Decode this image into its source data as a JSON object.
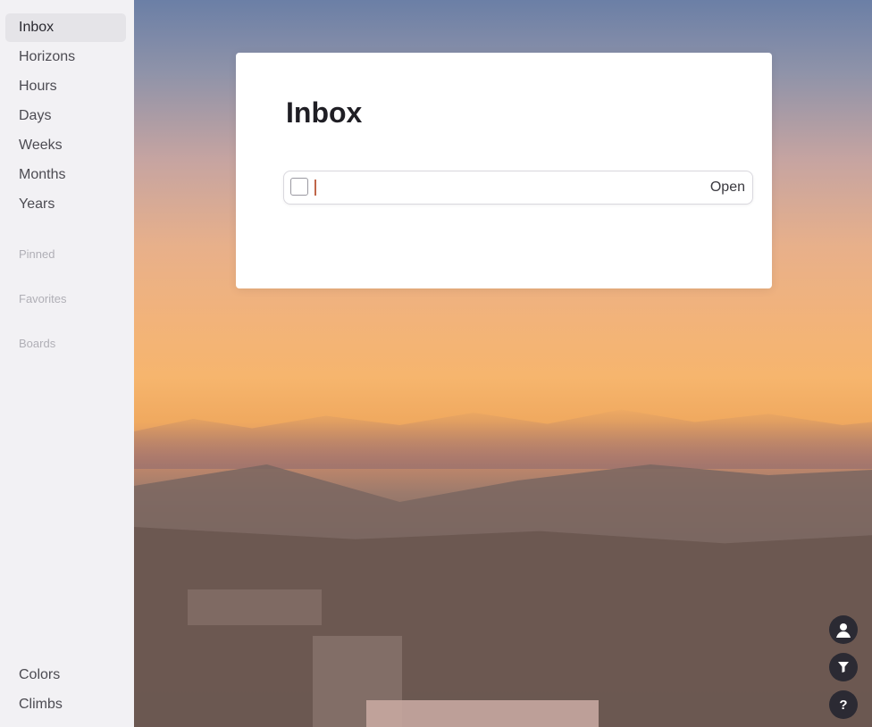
{
  "sidebar": {
    "nav": [
      {
        "label": "Inbox",
        "active": true
      },
      {
        "label": "Horizons"
      },
      {
        "label": "Hours"
      },
      {
        "label": "Days"
      },
      {
        "label": "Weeks"
      },
      {
        "label": "Months"
      },
      {
        "label": "Years"
      }
    ],
    "sections": [
      "Pinned",
      "Favorites",
      "Boards"
    ],
    "bottom": [
      {
        "label": "Colors"
      },
      {
        "label": "Climbs"
      }
    ]
  },
  "card": {
    "title": "Inbox",
    "task_input_value": "",
    "open_label": "Open"
  },
  "fab": {
    "profile_icon": "user-icon",
    "filter_icon": "filter-icon",
    "help_label": "?"
  },
  "colors": {
    "sidebar_bg": "#f2f1f4",
    "active_item_bg": "#e5e4e8",
    "fab_bg": "#2b2a33",
    "caret": "#c0664a"
  }
}
